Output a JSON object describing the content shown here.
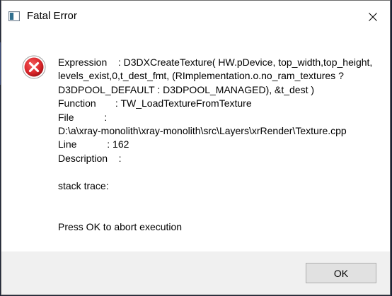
{
  "window": {
    "title": "Fatal Error",
    "icon": "app-window-icon",
    "close_icon": "close-icon"
  },
  "message": {
    "icon": "error-icon",
    "lines": [
      "Expression    : D3DXCreateTexture( HW.pDevice, top_width,top_height,",
      "levels_exist,0,t_dest_fmt, (RImplementation.o.no_ram_textures ?",
      "D3DPOOL_DEFAULT : D3DPOOL_MANAGED), &t_dest )",
      "Function       : TW_LoadTextureFromTexture",
      "File           :",
      "D:\\a\\xray-monolith\\xray-monolith\\src\\Layers\\xrRender\\Texture.cpp",
      "Line           : 162",
      "Description    :"
    ],
    "stack_trace": "stack trace:",
    "prompt": "Press OK to abort execution"
  },
  "buttons": {
    "ok_label": "OK"
  },
  "colors": {
    "error_red": "#d9262b",
    "footer_bg": "#f0f0f0",
    "button_bg": "#e1e1e1",
    "button_border": "#adadad"
  }
}
